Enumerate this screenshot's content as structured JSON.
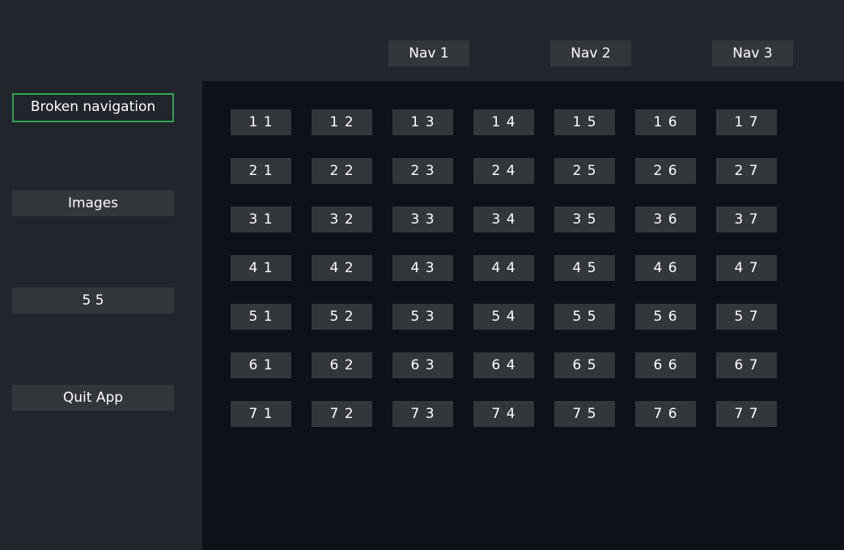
{
  "nav": {
    "items": [
      "Nav 1",
      "Nav 2",
      "Nav 3"
    ]
  },
  "sidebar": {
    "items": [
      {
        "label": "Broken navigation",
        "focused": true
      },
      {
        "label": "Images",
        "focused": false
      },
      {
        "label": "5 5",
        "focused": false
      },
      {
        "label": "Quit App",
        "focused": false
      }
    ]
  },
  "grid": {
    "rows": [
      [
        "1 1",
        "1 2",
        "1 3",
        "1 4",
        "1 5",
        "1 6",
        "1 7"
      ],
      [
        "2 1",
        "2 2",
        "2 3",
        "2 4",
        "2 5",
        "2 6",
        "2 7"
      ],
      [
        "3 1",
        "3 2",
        "3 3",
        "3 4",
        "3 5",
        "3 6",
        "3 7"
      ],
      [
        "4 1",
        "4 2",
        "4 3",
        "4 4",
        "4 5",
        "4 6",
        "4 7"
      ],
      [
        "5 1",
        "5 2",
        "5 3",
        "5 4",
        "5 5",
        "5 6",
        "5 7"
      ],
      [
        "6 1",
        "6 2",
        "6 3",
        "6 4",
        "6 5",
        "6 6",
        "6 7"
      ],
      [
        "7 1",
        "7 2",
        "7 3",
        "7 4",
        "7 5",
        "7 6",
        "7 7"
      ]
    ]
  },
  "colors": {
    "focus_border": "#2fa84f",
    "button_bg": "#33363b",
    "content_bg": "#0e1118",
    "chrome_bg": "#22252b"
  }
}
